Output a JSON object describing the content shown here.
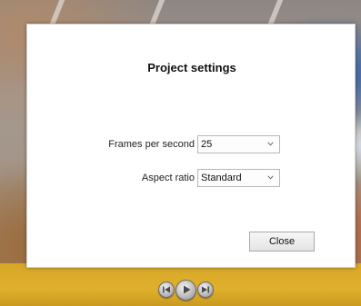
{
  "dialog": {
    "title": "Project settings",
    "fps_label": "Frames per second",
    "fps_value": "25",
    "aspect_label": "Aspect ratio",
    "aspect_value": "Standard",
    "close_label": "Close"
  },
  "icons": {
    "dropdown": "chevron-down-icon",
    "skip_back": "skip-back-icon",
    "play": "play-icon",
    "skip_forward": "skip-forward-icon"
  },
  "colors": {
    "transport_bar": "#e0b02c",
    "dialog_bg": "#ffffff"
  }
}
